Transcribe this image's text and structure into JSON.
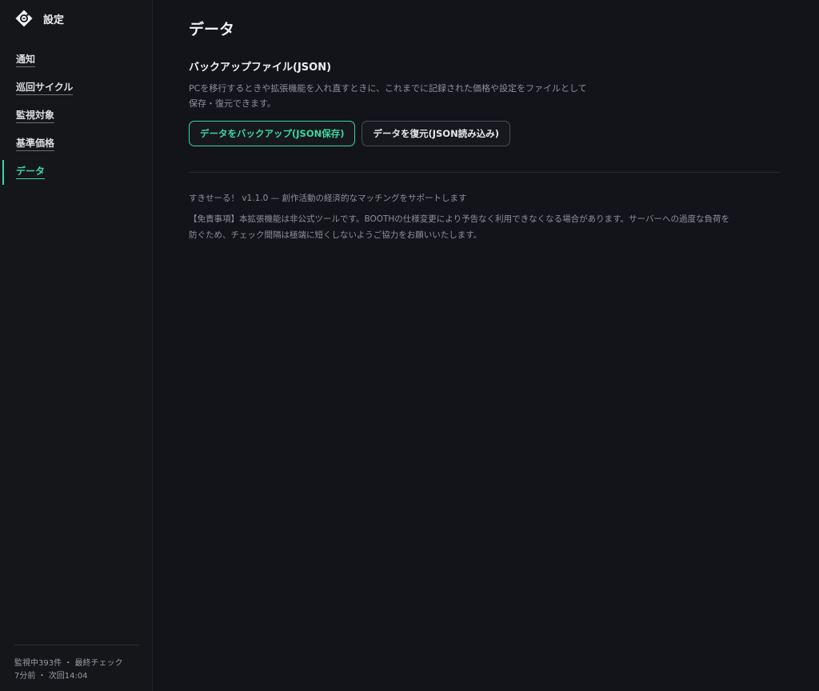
{
  "sidebar": {
    "brand_title": "設定",
    "items": [
      {
        "label": "通知",
        "active": false
      },
      {
        "label": "巡回サイクル",
        "active": false
      },
      {
        "label": "監視対象",
        "active": false
      },
      {
        "label": "基準価格",
        "active": false
      },
      {
        "label": "データ",
        "active": true
      }
    ],
    "footer_line1": "監視中393件 ・ 最終チェック",
    "footer_line2": "7分前 ・ 次回14:04"
  },
  "main": {
    "title": "データ",
    "backup": {
      "heading": "バックアップファイル(JSON)",
      "desc_line1": "PCを移行するときや拡張機能を入れ直すときに、これまでに記録された価格や設定をファイルとして",
      "desc_line2": "保存・復元できます。",
      "backup_button": "データをバックアップ(JSON保存)",
      "restore_button": "データを復元(JSON読み込み)"
    },
    "about": "すきせーる！ v1.1.0 — 創作活動の経済的なマッチングをサポートします",
    "disclaimer_line1": "【免責事項】本拡張機能は非公式ツールです。BOOTHの仕様変更により予告なく利用できなくなる場合があります。サーバーへの過度な負荷を",
    "disclaimer_line2": "防ぐため、チェック間隔は極端に短くしないようご協力をお願いいたします。"
  },
  "colors": {
    "accent": "#3dd6a0",
    "background": "#131419",
    "sidebar_background": "#151619",
    "muted_text": "#8e9099"
  },
  "icons": {
    "brand": "price-tag-icon"
  }
}
